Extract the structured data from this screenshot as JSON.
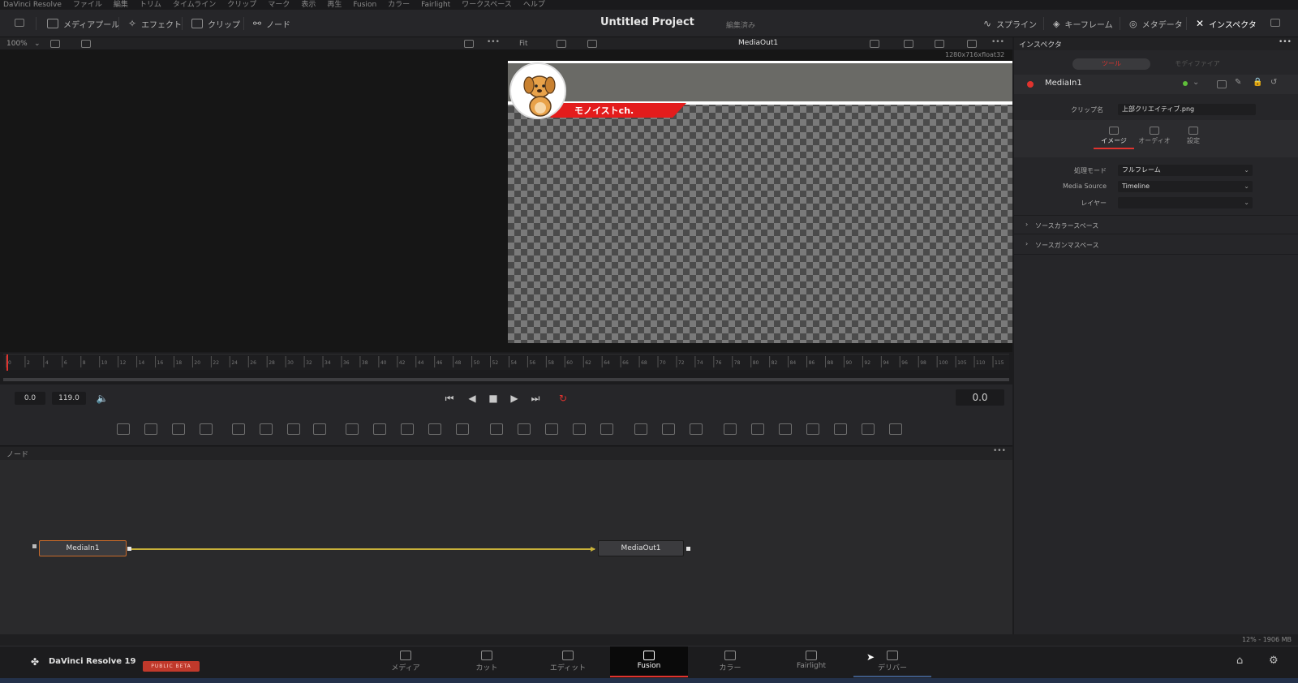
{
  "menubar": [
    "DaVinci Resolve",
    "ファイル",
    "編集",
    "トリム",
    "タイムライン",
    "クリップ",
    "マーク",
    "表示",
    "再生",
    "Fusion",
    "カラー",
    "Fairlight",
    "ワークスペース",
    "ヘルプ"
  ],
  "toolbar": {
    "media_pool": "メディアプール",
    "effects": "エフェクト",
    "clips": "クリップ",
    "nodes": "ノード",
    "project_title": "Untitled Project",
    "project_status": "編集済み",
    "spline": "スプライン",
    "keyframes": "キーフレーム",
    "metadata": "メタデータ",
    "inspector": "インスペクタ"
  },
  "viewer": {
    "zoom": "100%",
    "fit": "Fit",
    "right_title": "MediaOut1",
    "resolution": "1280x716xfloat32",
    "banner_text": "モノイストch."
  },
  "ruler_ticks": [
    "0",
    "2",
    "4",
    "6",
    "8",
    "10",
    "12",
    "14",
    "16",
    "18",
    "20",
    "22",
    "24",
    "26",
    "28",
    "30",
    "32",
    "34",
    "36",
    "38",
    "40",
    "42",
    "44",
    "46",
    "48",
    "50",
    "52",
    "54",
    "56",
    "58",
    "60",
    "62",
    "64",
    "66",
    "68",
    "70",
    "72",
    "74",
    "76",
    "78",
    "80",
    "82",
    "84",
    "86",
    "88",
    "90",
    "92",
    "94",
    "96",
    "98",
    "100",
    "105",
    "110",
    "115"
  ],
  "transport": {
    "start": "0.0",
    "end": "119.0",
    "current": "0.0"
  },
  "node_editor": {
    "title": "ノード",
    "node_in": "MediaIn1",
    "node_out": "MediaOut1"
  },
  "inspector": {
    "header": "インスペクタ",
    "tab_tools": "ツール",
    "tab_modifiers": "モディファイア",
    "node_name": "MediaIn1",
    "clip_label": "クリップ名",
    "clip_value": "上部クリエイティブ.png",
    "subtabs": [
      "イメージ",
      "オーディオ",
      "設定"
    ],
    "rows": [
      {
        "label": "処理モード",
        "value": "フルフレーム"
      },
      {
        "label": "Media Source",
        "value": "Timeline"
      },
      {
        "label": "レイヤー",
        "value": ""
      }
    ],
    "sections": [
      "ソースカラースペース",
      "ソースガンマスペース"
    ]
  },
  "status": {
    "memory": "12% - 1906 MB"
  },
  "pagebar": {
    "app_name": "DaVinci Resolve 19",
    "beta": "PUBLIC BETA",
    "pages": [
      "メディア",
      "カット",
      "エディット",
      "Fusion",
      "カラー",
      "Fairlight",
      "デリバー"
    ],
    "active": "Fusion"
  },
  "colors": {
    "accent_red": "#e0332e",
    "link_yellow": "#c8b13a",
    "banner_red": "#e31c1c"
  }
}
